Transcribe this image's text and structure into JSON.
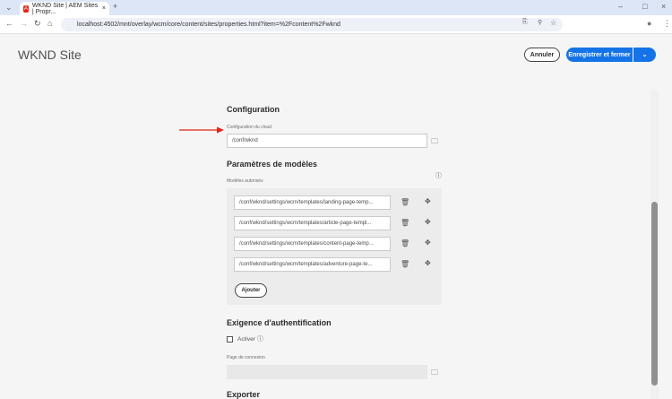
{
  "browser": {
    "tab_title": "WKND Site | AEM Sites | Propr...",
    "url": "localhost:4502/mnt/overlay/wcm/core/content/sites/properties.html?item=%2Fcontent%2Fwknd"
  },
  "header": {
    "title": "WKND Site",
    "cancel": "Annuler",
    "save": "Enregistrer et fermer"
  },
  "configuration": {
    "heading": "Configuration",
    "cloud_label": "Configuration du cloud",
    "cloud_value": "/conf/wknd"
  },
  "templates": {
    "heading": "Paramètres de modèles",
    "label": "Modèles autorisés",
    "items": [
      "/conf/wknd/settings/wcm/templates/landing-page-temp...",
      "/conf/wknd/settings/wcm/templates/article-page-templ...",
      "/conf/wknd/settings/wcm/templates/content-page-temp...",
      "/conf/wknd/settings/wcm/templates/adventure-page-te..."
    ],
    "add": "Ajouter"
  },
  "auth": {
    "heading": "Exigence d'authentification",
    "enable": "Activer",
    "login_label": "Page de connexion",
    "login_value": ""
  },
  "export": {
    "heading": "Exporter"
  },
  "colors": {
    "accent": "#1473e6",
    "arrow": "#e1251b"
  }
}
